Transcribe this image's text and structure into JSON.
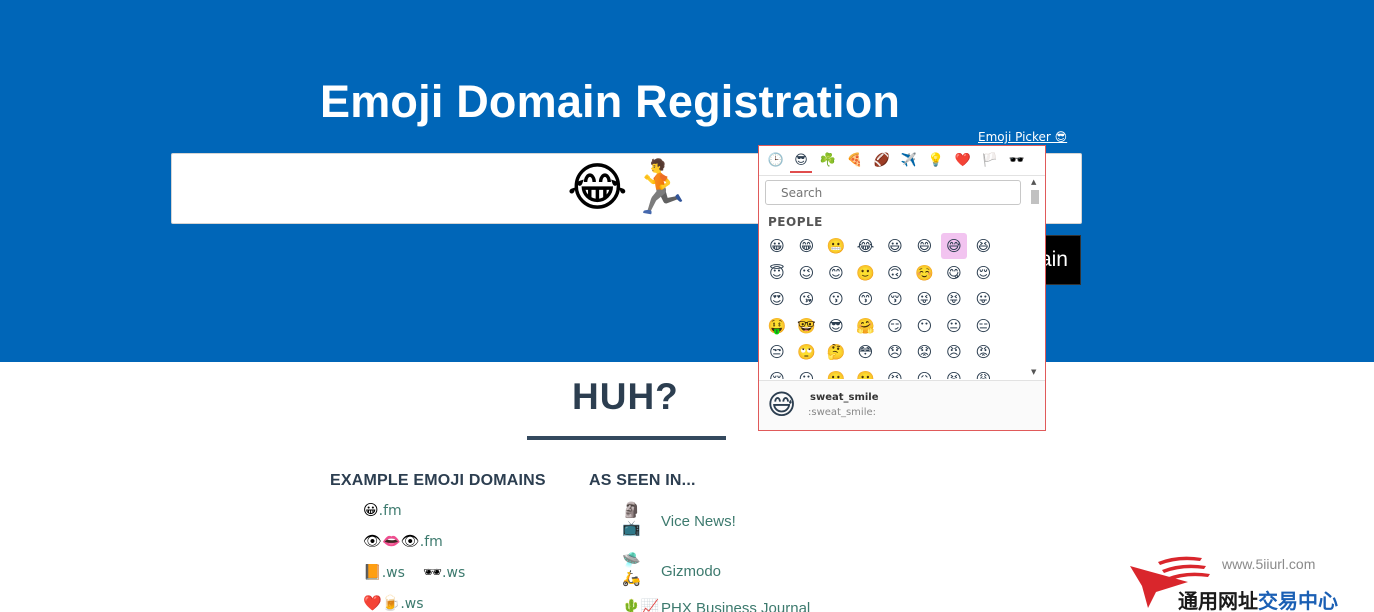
{
  "hero": {
    "title": "Emoji Domain Registration",
    "domain_value": "😂🏃",
    "register_label": "Register Domain",
    "picker_link": "Emoji Picker 😎"
  },
  "picker": {
    "categories": [
      "🕒",
      "😎",
      "☘️",
      "🍕",
      "🏈",
      "✈️",
      "💡",
      "❤️",
      "🏳️",
      "🕶️"
    ],
    "active_category": 1,
    "search_placeholder": "Search",
    "section_label": "PEOPLE",
    "selected_index": 6,
    "emoji_rows": [
      [
        "😀",
        "😁",
        "😬",
        "😂",
        "😃",
        "😄",
        "😅",
        "😆"
      ],
      [
        "😇",
        "😉",
        "😊",
        "🙂",
        "🙃",
        "☺️",
        "😋",
        "😌"
      ],
      [
        "😍",
        "😘",
        "😗",
        "😙",
        "😚",
        "😜",
        "😝",
        "😛"
      ],
      [
        "🤑",
        "🤓",
        "😎",
        "🤗",
        "😏",
        "😶",
        "😐",
        "😑"
      ],
      [
        "😒",
        "🙄",
        "🤔",
        "😳",
        "😞",
        "😟",
        "😠",
        "😡"
      ],
      [
        "😔",
        "😕",
        "🙁",
        "☹️",
        "😣",
        "😖",
        "😫",
        "😩"
      ]
    ],
    "preview": {
      "emoji": "😅",
      "name": "sweat_smile",
      "code": ":sweat_smile:"
    }
  },
  "section": {
    "heading": "HUH?"
  },
  "examples": {
    "heading": "EXAMPLE EMOJI DOMAINS",
    "items": [
      {
        "emoji": "😀",
        "tld": ".fm"
      },
      {
        "emoji": "👁👄👁",
        "tld": ".fm"
      },
      {
        "emoji": "📙",
        "tld": ".ws"
      },
      {
        "emoji": "🕶",
        "tld": ".ws"
      },
      {
        "emoji": "❤️🍺",
        "tld": ".ws"
      }
    ]
  },
  "press": {
    "heading": "AS SEEN IN...",
    "items": [
      {
        "icons": "🗿📺",
        "label": "Vice News!"
      },
      {
        "icons": "🛸🛵",
        "label": "Gizmodo"
      },
      {
        "icons": "🌵📈",
        "label": "PHX Business Journal"
      }
    ]
  },
  "watermark": {
    "url": "www.5iiurl.com",
    "text_a": "通用网址",
    "text_b": "交易中心",
    "colors": {
      "red": "#d9262c",
      "blue": "#1a5fb4"
    }
  }
}
